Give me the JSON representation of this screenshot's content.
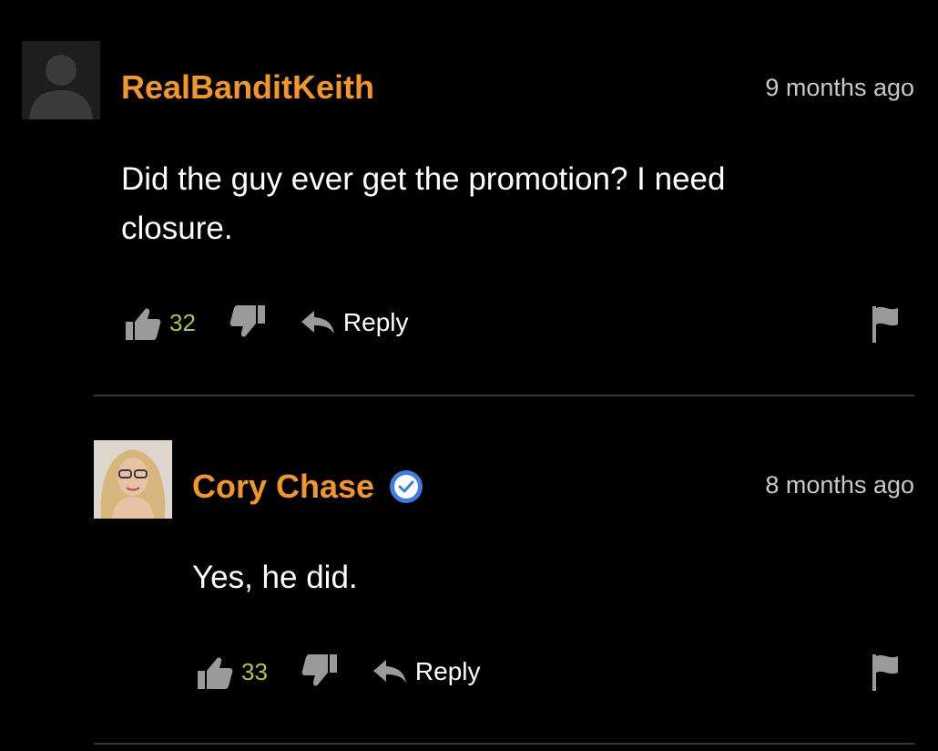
{
  "comments": [
    {
      "username": "RealBanditKeith",
      "timestamp": "9 months ago",
      "text": "Did the guy ever get the promotion? I need closure.",
      "likes": "32",
      "reply_label": "Reply",
      "verified": false
    },
    {
      "username": "Cory Chase",
      "timestamp": "8 months ago",
      "text": "Yes, he did.",
      "likes": "33",
      "reply_label": "Reply",
      "verified": true
    }
  ],
  "colors": {
    "background": "#000000",
    "username": "#f0962a",
    "like_count": "#a9c455",
    "timestamp": "#c8c8c8",
    "icon": "#9a9a9a",
    "verified_badge": "#3f7be0",
    "divider": "#3a3a3a"
  },
  "icons": [
    "default-avatar-icon",
    "thumbs-up-icon",
    "thumbs-down-icon",
    "reply-arrow-icon",
    "flag-icon",
    "verified-badge-icon"
  ]
}
